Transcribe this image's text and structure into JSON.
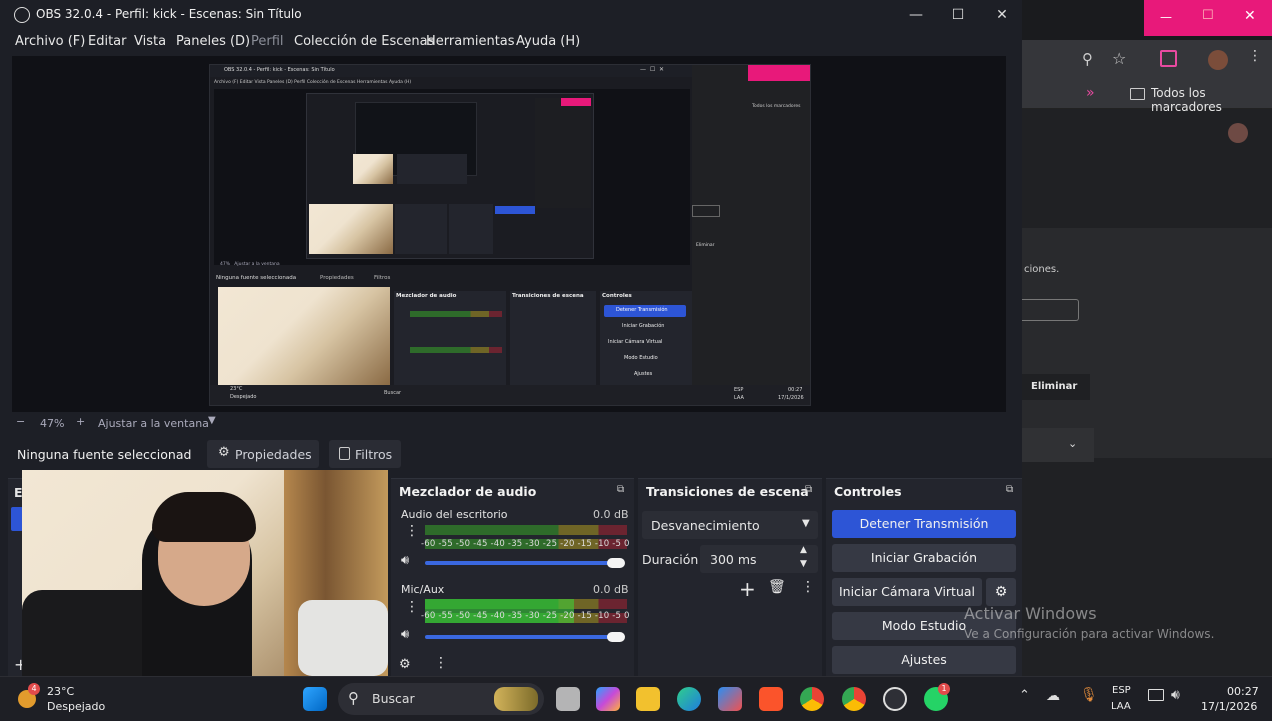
{
  "window": {
    "title": "OBS 32.0.4 - Perfil: kick - Escenas: Sin Título",
    "minimize": "—",
    "maximize": "☐",
    "close": "✕"
  },
  "menu": [
    "Archivo (F)",
    "Editar",
    "Vista",
    "Paneles (D)",
    "Perfil",
    "Colección de Escenas",
    "Herramientas",
    "Ayuda (H)"
  ],
  "zoom": {
    "minus": "−",
    "value": "47%",
    "plus": "+",
    "fit": "Ajustar a la ventana"
  },
  "source_bar": {
    "status": "Ninguna fuente seleccionad",
    "properties": "Propiedades",
    "filters": "Filtros"
  },
  "scenes_dock": {
    "title": "Es"
  },
  "mixer": {
    "title": "Mezclador de audio",
    "ticks": "-60 -55 -50 -45 -40 -35 -30 -25 -20 -15 -10 -5 0",
    "channels": [
      {
        "name": "Audio del escritorio",
        "db": "0.0 dB",
        "level": 0
      },
      {
        "name": "Mic/Aux",
        "db": "0.0 dB",
        "level": 0.74
      }
    ]
  },
  "transitions": {
    "title": "Transiciones de escena",
    "selected": "Desvanecimiento",
    "duration_label": "Duración",
    "duration_value": "300 ms"
  },
  "controls": {
    "title": "Controles",
    "stop_stream": "Detener Transmisión",
    "start_recording": "Iniciar Grabación",
    "start_virtualcam": "Iniciar Cámara Virtual",
    "studio_mode": "Modo Estudio",
    "settings": "Ajustes"
  },
  "activation": {
    "title": "Activar Windows",
    "subtitle": "Ve a Configuración para activar Windows."
  },
  "chrome": {
    "bookmarks": "Todos los marcadores",
    "fragment": "ciones.",
    "delete_button": "Eliminar"
  },
  "inner_preview": {
    "title": "OBS 32.0.4 - Perfil: kick - Escenas: Sin Título",
    "menu": "Archivo (F)   Editar   Vista   Paneles (D)   Perfil   Colección de Escenas   Herramientas   Ayuda (H)",
    "no_source": "Ninguna fuente seleccionada",
    "properties": "Propiedades",
    "filters": "Filtros",
    "mixer": "Mezclador de audio",
    "transitions": "Transiciones de escena",
    "controls": "Controles",
    "stop": "Detener Transmisión",
    "rec": "Iniciar Grabación",
    "vcam": "Iniciar Cámara Virtual",
    "studio": "Modo Estudio",
    "settings": "Ajustes",
    "zoom": "47%   Ajustar a la ventana",
    "bookmarks": "Todos los marcadores",
    "delete": "Eliminar",
    "weather_temp": "23°C",
    "weather_text": "Despejado",
    "search": "Buscar",
    "lang": "ESP",
    "lang2": "LAA",
    "time": "00:27",
    "date": "17/1/2026"
  },
  "taskbar": {
    "weather_temp": "23°C",
    "weather_text": "Despejado",
    "weather_badge": "4",
    "search": "Buscar",
    "lang": "ESP",
    "lang2": "LAA",
    "time": "00:27",
    "date": "17/1/2026",
    "whatsapp_badge": "1"
  }
}
